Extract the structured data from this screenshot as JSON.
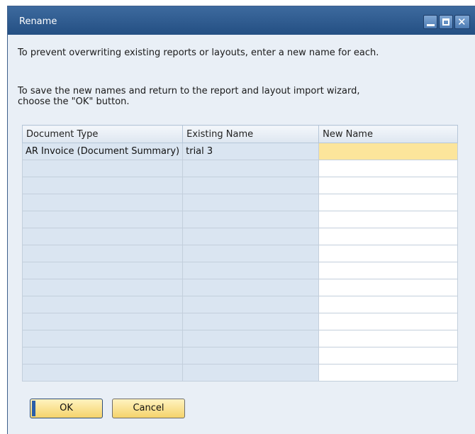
{
  "window": {
    "title": "Rename",
    "controls": {
      "minimize": "minimize-icon",
      "maximize": "maximize-icon",
      "close": "close-icon"
    }
  },
  "messages": {
    "line1": "To prevent overwriting existing reports or layouts, enter a new name for each.",
    "line2": "To save the new names and return to the report and layout import wizard,\nchoose the \"OK\" button."
  },
  "table": {
    "columns": [
      "Document Type",
      "Existing Name",
      "New Name"
    ],
    "rows": [
      [
        "AR Invoice (Document Summary)",
        "trial 3",
        ""
      ]
    ]
  },
  "buttons": {
    "ok": "OK",
    "cancel": "Cancel"
  },
  "colors": {
    "titlebar": "#2c5a8f",
    "active_cell": "#fce59b",
    "readonly_cell": "#dae5f1",
    "button": "#f5d36b"
  }
}
